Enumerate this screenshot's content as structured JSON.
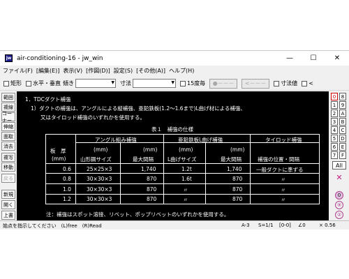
{
  "window": {
    "title": "air-conditioning-16 - jw_win",
    "app_icon": "jw",
    "controls": {
      "minimize": "—",
      "maximize": "☐",
      "close": "✕"
    }
  },
  "menu": [
    "ファイル(F)",
    "[編集(E)]",
    "表示(V)",
    "[作図(D)]",
    "設定(S)",
    "[その他(A)]",
    "ヘルプ(H)"
  ],
  "toolbar": {
    "rect_label": "矩形",
    "hv_label": "水平・垂直",
    "angle_label": "傾き",
    "dim_label": "寸法",
    "deg15_label": "15度毎",
    "btn_circle": "●－－－",
    "btn_arrows": "<－－－",
    "dimvalue_label": "寸法値",
    "lt_label": "<"
  },
  "left_buttons": [
    {
      "label": "範囲",
      "disabled": false
    },
    {
      "label": "複線",
      "disabled": false
    },
    {
      "label": "コーナー",
      "disabled": false
    },
    {
      "label": "伸縮",
      "disabled": false
    },
    {
      "label": "面取",
      "disabled": false
    },
    {
      "label": "消去",
      "disabled": false
    },
    {
      "label": "複写",
      "disabled": false
    },
    {
      "label": "移動",
      "disabled": false
    },
    {
      "label": "戻る",
      "disabled": true
    },
    {
      "label": "新規",
      "disabled": false
    },
    {
      "label": "開く",
      "disabled": false
    },
    {
      "label": "上書",
      "disabled": false
    }
  ],
  "right_buttons": [
    {
      "label": "0",
      "red": true
    },
    {
      "label": "8",
      "red": false
    },
    {
      "label": "1",
      "red": false
    },
    {
      "label": "9",
      "red": false
    },
    {
      "label": "2",
      "red": false
    },
    {
      "label": "A",
      "red": false
    },
    {
      "label": "3",
      "red": false
    },
    {
      "label": "B",
      "red": false
    },
    {
      "label": "4",
      "red": false
    },
    {
      "label": "C",
      "red": false
    },
    {
      "label": "5",
      "red": false
    },
    {
      "label": "D",
      "red": false
    },
    {
      "label": "6",
      "red": false
    },
    {
      "label": "E",
      "red": false
    },
    {
      "label": "7",
      "red": false
    },
    {
      "label": "F",
      "red": false
    }
  ],
  "right_all": "All",
  "right_x": "✕",
  "right_circles": [
    "0",
    "⑨",
    "②"
  ],
  "canvas": {
    "heading": "1．TDCダクト補強",
    "line1": "1）ダクトの補強は、アングルによる縦補強、亜鉛鉄板(1.2〜1.6まで)L曲げ材による補強、",
    "line2": "又はタイロッド補強のいずれかを使用する。",
    "table_title": "表１　補強の仕様",
    "headers": {
      "thickness": "板　厚",
      "thickness_unit": "(mm)",
      "angle": "アングル組み補強",
      "galv": "亜鉛鉄板L曲げ補強",
      "tierod": "タイロッド補強",
      "mm1": "(mm)",
      "mm2": "(mm)",
      "mm3": "(mm)",
      "mm4": "(mm)",
      "angle_size": "山形鋼サイズ",
      "max_spacing1": "最大間隔",
      "l_size": "L曲げサイズ",
      "max_spacing2": "最大間隔",
      "pos_spacing": "補強の位置・間隔"
    },
    "rows": [
      {
        "thickness": "0.6",
        "angle_size": "25×25×3",
        "max1": "1,740",
        "l_size": "1.2t",
        "max2": "1,740",
        "tierod": "一般ダクトに準ずる"
      },
      {
        "thickness": "0.8",
        "angle_size": "30×30×3",
        "max1": "870",
        "l_size": "1.6t",
        "max2": "870",
        "tierod": "〃"
      },
      {
        "thickness": "1.0",
        "angle_size": "30×30×3",
        "max1": "870",
        "l_size": "〃",
        "max2": "870",
        "tierod": "〃"
      },
      {
        "thickness": "1.2",
        "angle_size": "30×30×3",
        "max1": "870",
        "l_size": "〃",
        "max2": "870",
        "tierod": "〃"
      }
    ],
    "note": "注：補強はスポット溶接、リベット、ポップリベットのいずれかを使用する。"
  },
  "status": {
    "message": "始点を指示してください　(L)free　(R)Read",
    "sheet": "A-3",
    "scale": "S=1/1",
    "layer": "[0-0]",
    "angle": "∠0",
    "zoom": "× 0.56"
  }
}
